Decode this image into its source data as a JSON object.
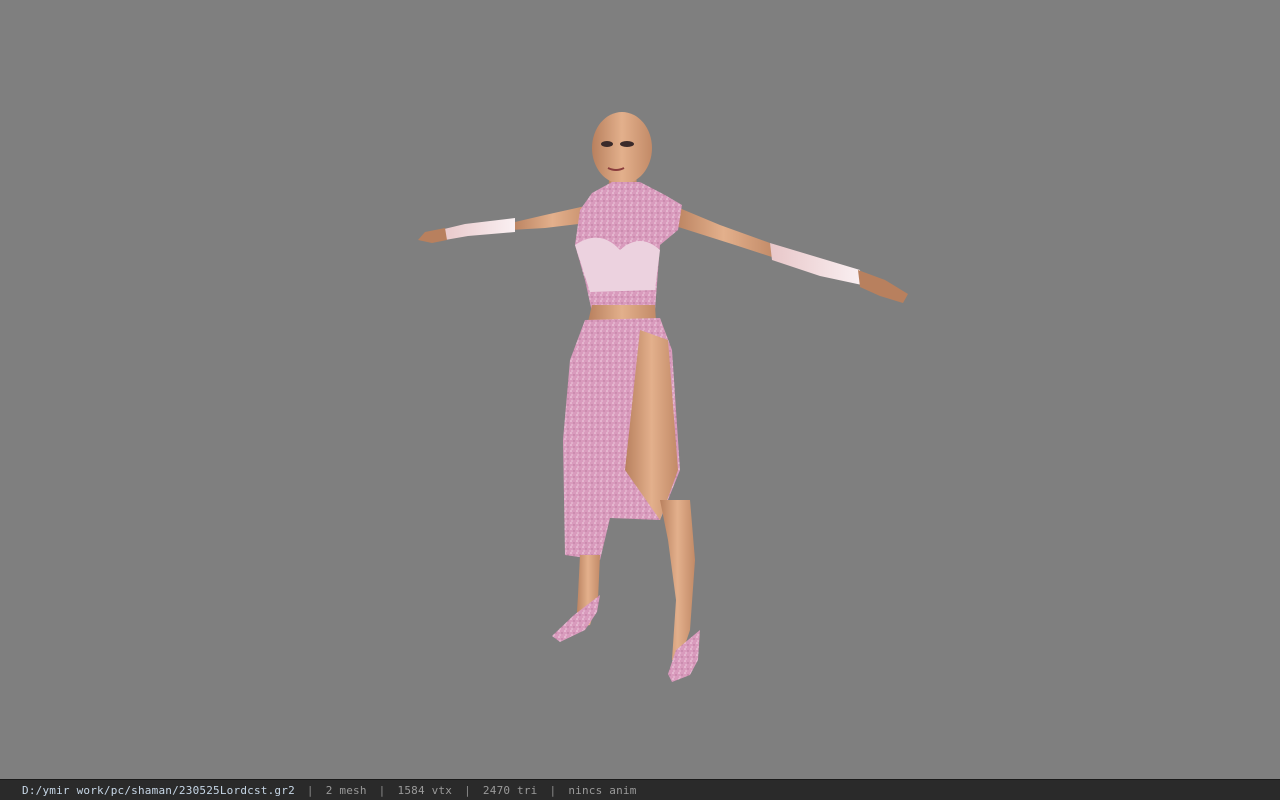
{
  "viewport": {
    "background": "#7f7f7f",
    "model_icon": "character-model"
  },
  "status_bar": {
    "file_path": "D:/ymir work/pc/shaman/230525Lordcst.gr2",
    "separator": "|",
    "mesh_count": "2 mesh",
    "vertex_count": "1584 vtx",
    "triangle_count": "2470 tri",
    "anim_info": "nincs anim"
  },
  "colors": {
    "dress_pink": "#d99bbd",
    "skin": "#d9a27f",
    "status_bg": "#2a2a2a"
  }
}
